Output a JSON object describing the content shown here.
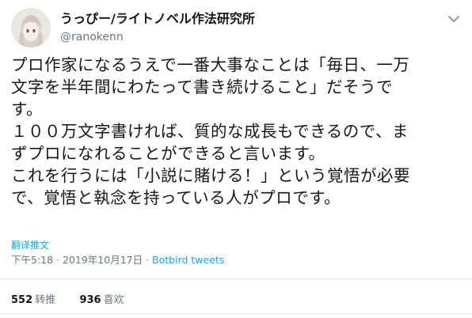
{
  "author": {
    "display_name": "うっぴー/ライトノベル作法研究所",
    "handle": "@ranokenn"
  },
  "tweet": {
    "lines": [
      "プロ作家になるうえで一番大事なことは「毎日、一万",
      "文字を半年間にわたって書き続けること」だそうで",
      "す。",
      "１００万文字書ければ、質的な成長もできるので、ま",
      "ずプロになれることができると言います。",
      "これを行うには「小説に賭ける！」という覚悟が必要",
      "で、覚悟と執念を持っている人がプロです。"
    ],
    "translate_label": "翻译推文",
    "timestamp": "下午5:18 · 2019年10月17日 · ",
    "source": "Botbird tweets"
  },
  "stats": {
    "retweets_count": "552",
    "retweets_label": "转推",
    "likes_count": "936",
    "likes_label": "喜欢"
  },
  "colors": {
    "link": "#1da1f2",
    "muted": "#657786",
    "text": "#14171a"
  }
}
